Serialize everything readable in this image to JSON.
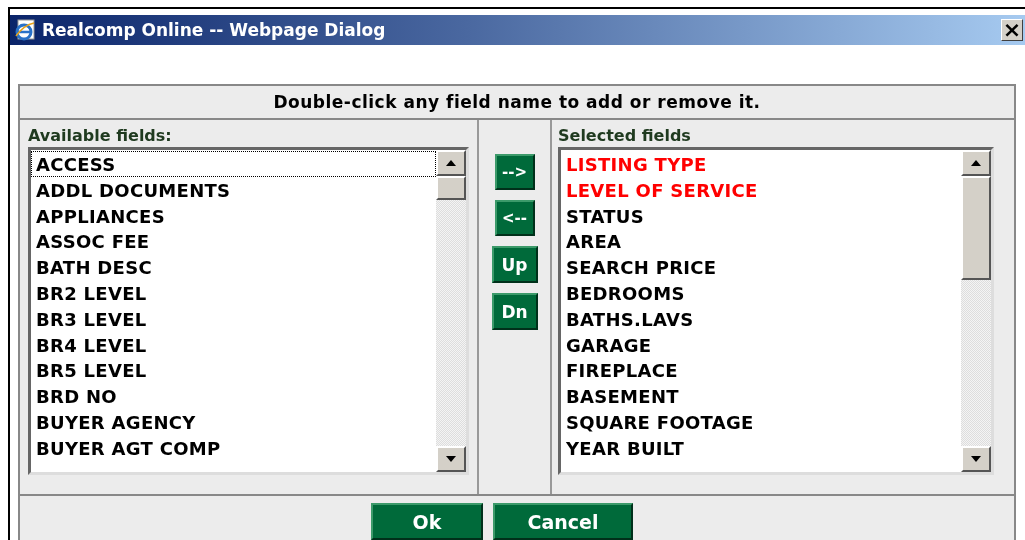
{
  "window": {
    "title": "Realcomp Online -- Webpage Dialog",
    "close": "×"
  },
  "instruction": "Double-click any field name to add or remove it.",
  "available": {
    "label": "Available fields:",
    "items": [
      {
        "text": "ACCESS",
        "focused": true
      },
      {
        "text": "ADDL DOCUMENTS",
        "focused": false
      },
      {
        "text": "APPLIANCES",
        "focused": false
      },
      {
        "text": "ASSOC FEE",
        "focused": false
      },
      {
        "text": "BATH DESC",
        "focused": false
      },
      {
        "text": "BR2 LEVEL",
        "focused": false
      },
      {
        "text": "BR3 LEVEL",
        "focused": false
      },
      {
        "text": "BR4 LEVEL",
        "focused": false
      },
      {
        "text": "BR5 LEVEL",
        "focused": false
      },
      {
        "text": "BRD NO",
        "focused": false
      },
      {
        "text": "BUYER AGENCY",
        "focused": false
      },
      {
        "text": "BUYER AGT COMP",
        "focused": false
      }
    ]
  },
  "move_buttons": [
    "-->",
    "<--",
    "Up",
    "Dn"
  ],
  "selected": {
    "label": "Selected fields",
    "items": [
      {
        "text": "LISTING TYPE",
        "color": "#ff0000"
      },
      {
        "text": "LEVEL OF SERVICE",
        "color": "#ff0000"
      },
      {
        "text": "STATUS",
        "color": "#000000"
      },
      {
        "text": "AREA",
        "color": "#000000"
      },
      {
        "text": "SEARCH PRICE",
        "color": "#000000"
      },
      {
        "text": "BEDROOMS",
        "color": "#000000"
      },
      {
        "text": "BATHS.LAVS",
        "color": "#000000"
      },
      {
        "text": "GARAGE",
        "color": "#000000"
      },
      {
        "text": "FIREPLACE",
        "color": "#000000"
      },
      {
        "text": "BASEMENT",
        "color": "#000000"
      },
      {
        "text": "SQUARE FOOTAGE",
        "color": "#000000"
      },
      {
        "text": "YEAR BUILT",
        "color": "#000000"
      }
    ]
  },
  "buttons": [
    "Ok",
    "Cancel"
  ]
}
